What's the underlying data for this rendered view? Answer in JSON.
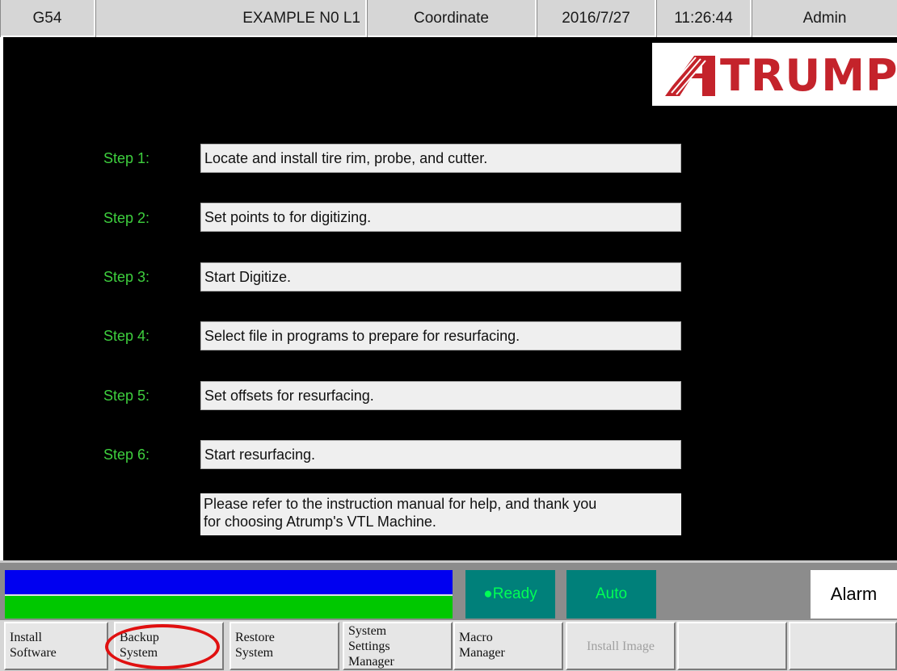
{
  "header": {
    "work_offset": "G54",
    "program": "EXAMPLE N0 L1",
    "mode": "Coordinate",
    "date": "2016/7/27",
    "time": "11:26:44",
    "user": "Admin"
  },
  "logo": {
    "text": "TRUMP",
    "brand_color": "#c4232b"
  },
  "steps": [
    {
      "label": "Step 1:",
      "text": "Locate and install tire rim, probe, and cutter."
    },
    {
      "label": "Step 2:",
      "text": "Set points to for digitizing."
    },
    {
      "label": "Step 3:",
      "text": "Start Digitize."
    },
    {
      "label": "Step 4:",
      "text": "Select file in programs to prepare for resurfacing."
    },
    {
      "label": "Step 5:",
      "text": "Set offsets for resurfacing."
    },
    {
      "label": "Step 6:",
      "text": "Start resurfacing."
    }
  ],
  "note": {
    "line1": "Please refer to the instruction manual for help, and thank you",
    "line2": "for choosing Atrump's VTL Machine."
  },
  "status": {
    "ready": "●Ready",
    "auto": "Auto",
    "alarm": "Alarm",
    "colors": {
      "progress_top": "#0000f0",
      "progress_bottom": "#00c800",
      "indicator_bg": "#00807a",
      "indicator_text": "#00ff55"
    }
  },
  "function_keys": [
    {
      "line1": "Install",
      "line2": "Software",
      "enabled": true
    },
    {
      "line1": "Backup",
      "line2": "System",
      "enabled": true,
      "highlighted": true
    },
    {
      "line1": "Restore",
      "line2": "System",
      "enabled": true
    },
    {
      "line1": "System",
      "line2": "Settings",
      "line3": "Manager",
      "enabled": true
    },
    {
      "line1": "Macro",
      "line2": "Manager",
      "enabled": true
    },
    {
      "line1": "Install Image",
      "enabled": false
    },
    {
      "line1": "",
      "enabled": true
    },
    {
      "line1": "",
      "enabled": true
    }
  ]
}
